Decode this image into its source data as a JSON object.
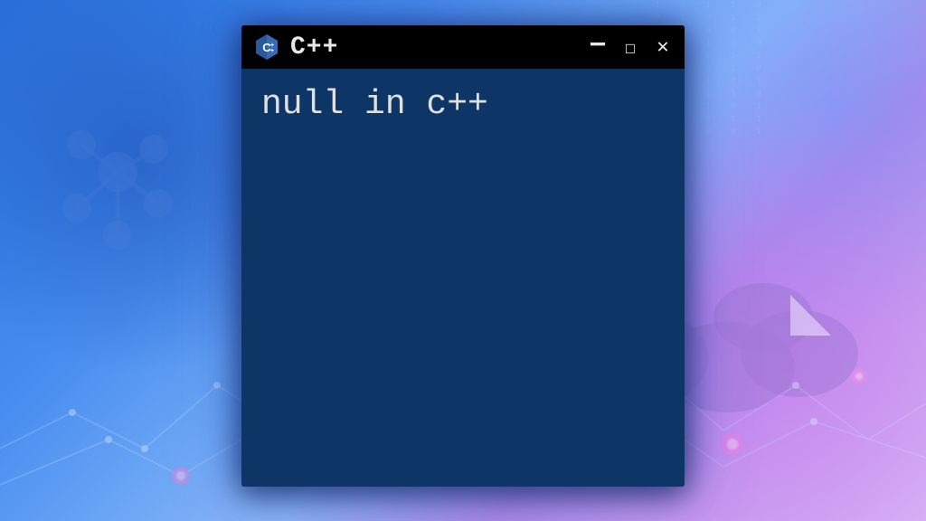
{
  "window": {
    "title": "C++",
    "icon_label": "C++"
  },
  "terminal": {
    "content": "null in c++"
  },
  "controls": {
    "minimize": "−",
    "maximize": "□",
    "close": "✕"
  }
}
